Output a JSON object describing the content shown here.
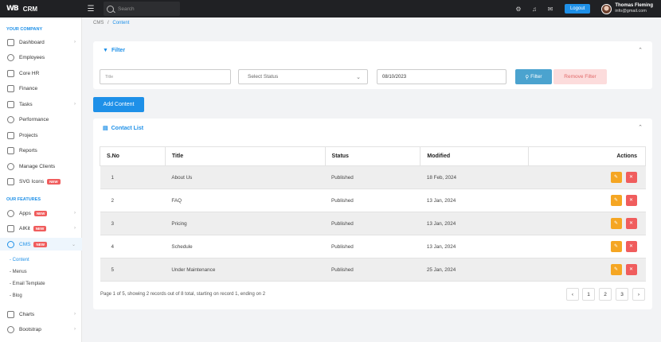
{
  "app": {
    "logo": "WB",
    "name": "CRM"
  },
  "topbar": {
    "search_placeholder": "Search",
    "logout_label": "Logout",
    "user_name": "Thomas Fleming",
    "user_email": "info@gmail.com"
  },
  "sidebar": {
    "section_company": "YOUR COMPANY",
    "company_items": [
      {
        "label": "Dashboard"
      },
      {
        "label": "Employees"
      },
      {
        "label": "Core HR"
      },
      {
        "label": "Finance"
      },
      {
        "label": "Tasks"
      },
      {
        "label": "Performance"
      },
      {
        "label": "Projects"
      },
      {
        "label": "Reports"
      },
      {
        "label": "Manage Clients"
      },
      {
        "label": "SVG Icons",
        "badge": "NEW"
      }
    ],
    "section_features": "OUR FEATURES",
    "feature_items": [
      {
        "label": "Apps",
        "badge": "NEW"
      },
      {
        "label": "AIKit",
        "badge": "NEW"
      },
      {
        "label": "CMS",
        "badge": "NEW"
      }
    ],
    "cms_sub": [
      "Content",
      "Menus",
      "Email Template",
      "Blog"
    ],
    "more_items": [
      {
        "label": "Charts"
      },
      {
        "label": "Bootstrap"
      }
    ]
  },
  "breadcrumb": {
    "parent": "CMS",
    "separator": "/",
    "current": "Content"
  },
  "filter": {
    "title": "Filter",
    "title_placeholder": "Title",
    "status_placeholder": "Select Status",
    "date_value": "08/10/2023",
    "filter_label": "Filter",
    "remove_label": "Remove Filter"
  },
  "add_button": "Add Content",
  "list": {
    "title": "Contact List",
    "columns": [
      "S.No",
      "Title",
      "Status",
      "Modified",
      "Actions"
    ],
    "rows": [
      {
        "sno": "1",
        "title": "About Us",
        "status": "Published",
        "modified": "18 Feb, 2024"
      },
      {
        "sno": "2",
        "title": "FAQ",
        "status": "Published",
        "modified": "13 Jan, 2024"
      },
      {
        "sno": "3",
        "title": "Pricing",
        "status": "Published",
        "modified": "13 Jan, 2024"
      },
      {
        "sno": "4",
        "title": "Schedule",
        "status": "Published",
        "modified": "13 Jan, 2024"
      },
      {
        "sno": "5",
        "title": "Under Maintenance",
        "status": "Published",
        "modified": "25 Jan, 2024"
      }
    ]
  },
  "pagination": {
    "info": "Page 1 of 5, showing 2 records out of 8 total, starting on record 1, ending on 2",
    "pages": [
      "1",
      "2",
      "3"
    ]
  },
  "colors": {
    "primary": "#1e90e8",
    "topbar": "#202124",
    "danger": "#f05d5d",
    "warning": "#f5a623"
  }
}
